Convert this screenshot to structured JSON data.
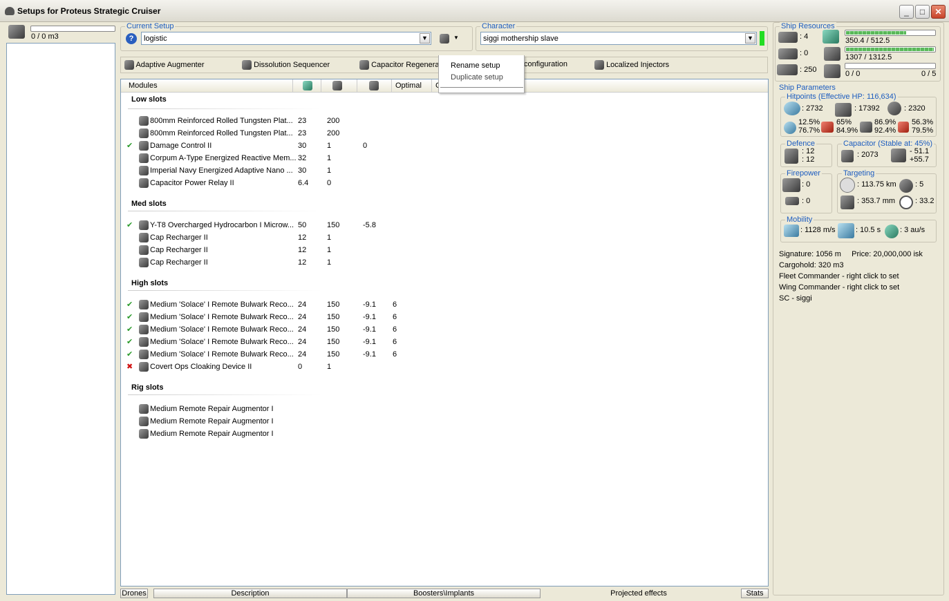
{
  "window": {
    "title": "Setups for Proteus Strategic Cruiser"
  },
  "left": {
    "cargo": "0 / 0 m3"
  },
  "setup": {
    "label": "Current Setup",
    "value": "logistic"
  },
  "character": {
    "label": "Character",
    "value": "siggi mothership slave"
  },
  "context_menu": {
    "items": [
      "Rename setup",
      "Duplicate setup"
    ]
  },
  "subsystems": [
    "Adaptive Augmenter",
    "Dissolution Sequencer",
    "Capacitor Regenera",
    "configuration",
    "Localized Injectors"
  ],
  "module_columns": [
    "Modules",
    "Optimal",
    "C"
  ],
  "sections": {
    "low": "Low slots",
    "med": "Med slots",
    "high": "High slots",
    "rig": "Rig slots"
  },
  "low_slots": [
    {
      "name": "800mm Reinforced Rolled Tungsten Plat...",
      "cpu": "23",
      "pg": "200",
      "cap": "",
      "opt": "",
      "state": ""
    },
    {
      "name": "800mm Reinforced Rolled Tungsten Plat...",
      "cpu": "23",
      "pg": "200",
      "cap": "",
      "opt": "",
      "state": ""
    },
    {
      "name": "Damage Control II",
      "cpu": "30",
      "pg": "1",
      "cap": "0",
      "opt": "",
      "state": "✔"
    },
    {
      "name": "Corpum A-Type Energized Reactive Mem...",
      "cpu": "32",
      "pg": "1",
      "cap": "",
      "opt": "",
      "state": ""
    },
    {
      "name": "Imperial Navy Energized Adaptive Nano ...",
      "cpu": "30",
      "pg": "1",
      "cap": "",
      "opt": "",
      "state": ""
    },
    {
      "name": "Capacitor Power Relay II",
      "cpu": "6.4",
      "pg": "0",
      "cap": "",
      "opt": "",
      "state": ""
    }
  ],
  "med_slots": [
    {
      "name": "Y-T8 Overcharged Hydrocarbon I Microw...",
      "cpu": "50",
      "pg": "150",
      "cap": "-5.8",
      "opt": "",
      "state": "✔"
    },
    {
      "name": "Cap Recharger II",
      "cpu": "12",
      "pg": "1",
      "cap": "",
      "opt": "",
      "state": ""
    },
    {
      "name": "Cap Recharger II",
      "cpu": "12",
      "pg": "1",
      "cap": "",
      "opt": "",
      "state": ""
    },
    {
      "name": "Cap Recharger II",
      "cpu": "12",
      "pg": "1",
      "cap": "",
      "opt": "",
      "state": ""
    }
  ],
  "high_slots": [
    {
      "name": "Medium 'Solace' I Remote Bulwark Reco...",
      "cpu": "24",
      "pg": "150",
      "cap": "-9.1",
      "opt": "6",
      "state": "✔"
    },
    {
      "name": "Medium 'Solace' I Remote Bulwark Reco...",
      "cpu": "24",
      "pg": "150",
      "cap": "-9.1",
      "opt": "6",
      "state": "✔"
    },
    {
      "name": "Medium 'Solace' I Remote Bulwark Reco...",
      "cpu": "24",
      "pg": "150",
      "cap": "-9.1",
      "opt": "6",
      "state": "✔"
    },
    {
      "name": "Medium 'Solace' I Remote Bulwark Reco...",
      "cpu": "24",
      "pg": "150",
      "cap": "-9.1",
      "opt": "6",
      "state": "✔"
    },
    {
      "name": "Medium 'Solace' I Remote Bulwark Reco...",
      "cpu": "24",
      "pg": "150",
      "cap": "-9.1",
      "opt": "6",
      "state": "✔"
    },
    {
      "name": "Covert Ops Cloaking Device II",
      "cpu": "0",
      "pg": "1",
      "cap": "",
      "opt": "",
      "state": "✖"
    }
  ],
  "rig_slots": [
    {
      "name": "Medium Remote Repair Augmentor I",
      "cpu": "",
      "pg": "",
      "cap": "",
      "opt": "",
      "state": ""
    },
    {
      "name": "Medium Remote Repair Augmentor I",
      "cpu": "",
      "pg": "",
      "cap": "",
      "opt": "",
      "state": ""
    },
    {
      "name": "Medium Remote Repair Augmentor I",
      "cpu": "",
      "pg": "",
      "cap": "",
      "opt": "",
      "state": ""
    }
  ],
  "bottom_tabs": [
    "Drones",
    "Description",
    "Boosters\\Implants",
    "Projected effects",
    "Stats"
  ],
  "resources": {
    "label": "Ship Resources",
    "hardpoints_turret": ": 4",
    "hardpoints_launcher": ": 0",
    "calibration": ": 250",
    "cpu": "350.4 / 512.5",
    "cpu_fraction": 0.68,
    "pg": "1307 / 1312.5",
    "pg_fraction": 0.996,
    "drone_bay": "0 / 0",
    "drone_bw": "0 / 5"
  },
  "params": {
    "label": "Ship Parameters",
    "hp_label": "Hitpoints (Effective HP: 116,634)",
    "shield": ": 2732",
    "armor": ": 17392",
    "structure": ": 2320",
    "res_em": [
      "12.5%",
      "76.7%"
    ],
    "res_th": [
      "65%",
      "84.9%"
    ],
    "res_ki": [
      "86.9%",
      "92.4%"
    ],
    "res_ex": [
      "56.3%",
      "79.5%"
    ],
    "defence_label": "Defence",
    "defence": [
      ": 12",
      ": 12"
    ],
    "cap_label": "Capacitor (Stable at: 45%)",
    "cap_amount": ": 2073",
    "cap_delta": [
      "- 51.1",
      "+55.7"
    ],
    "fire_label": "Firepower",
    "fire": [
      ": 0",
      ": 0"
    ],
    "target_label": "Targeting",
    "range": ": 113.75 km",
    "max_targets": ": 5",
    "scan_res": ": 353.7 mm",
    "sensor": ": 33.2",
    "mob_label": "Mobility",
    "speed": ": 1128 m/s",
    "align": ": 10.5 s",
    "warp": ": 3 au/s"
  },
  "info": [
    "Signature: 1056 m     Price: 20,000,000 isk",
    "Cargohold: 320 m3",
    "Fleet Commander - right click to set",
    "Wing Commander - right click to set",
    "SC - siggi"
  ]
}
